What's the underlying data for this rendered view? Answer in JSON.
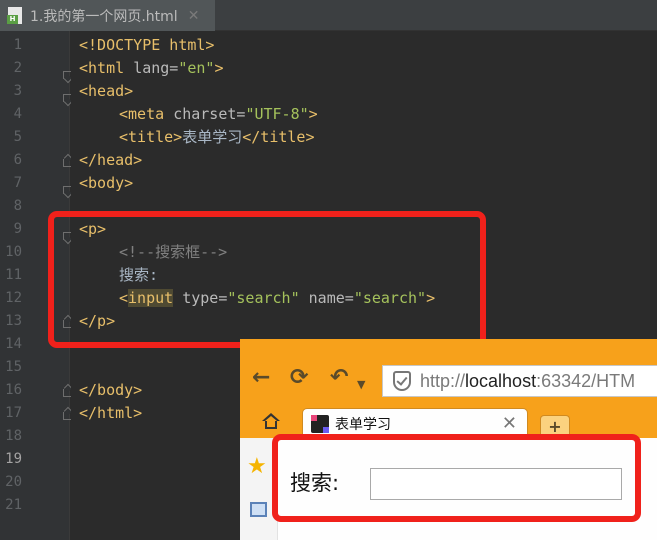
{
  "ide": {
    "tab": {
      "title": "1.我的第一个网页.html",
      "badge": "H",
      "close": "✕"
    },
    "line_numbers": [
      "1",
      "2",
      "3",
      "4",
      "5",
      "6",
      "7",
      "8",
      "9",
      "10",
      "11",
      "12",
      "13",
      "14",
      "15",
      "16",
      "17",
      "18",
      "19",
      "20",
      "21"
    ],
    "code": {
      "l1": {
        "a": "<!DOCTYPE html>"
      },
      "l2": {
        "a": "<html ",
        "b": "lang=",
        "c": "\"en\"",
        "d": ">"
      },
      "l3": {
        "a": "<head>"
      },
      "l4": {
        "a": "<meta ",
        "b": "charset=",
        "c": "\"UTF-8\"",
        "d": ">"
      },
      "l5": {
        "a": "<title>",
        "b": "表单学习",
        "c": "</title>"
      },
      "l6": {
        "a": "</head>"
      },
      "l7": {
        "a": "<body>"
      },
      "l9": {
        "a": "<p>"
      },
      "l10": {
        "a": "<!--搜索框-->"
      },
      "l11": {
        "a": "搜索:"
      },
      "l12": {
        "a": "<",
        "b": "input",
        "c": " type=",
        "d": "\"search\"",
        "e": " name=",
        "f": "\"search\"",
        "g": ">"
      },
      "l13": {
        "a": "</p>"
      },
      "l16": {
        "a": "</body>"
      },
      "l17": {
        "a": "</html>"
      }
    }
  },
  "browser": {
    "url_protocol": "http://",
    "url_host": "localhost",
    "url_rest": ":63342/HTM",
    "tab_title": "表单学习",
    "tab_close": "✕",
    "new_tab": "+",
    "search_label": "搜索:",
    "search_value": ""
  },
  "colors": {
    "highlight_box": "#f0211b",
    "browser_chrome": "#f7a11b",
    "tag": "#e8bf6a",
    "string": "#a5c25c",
    "comment": "#808080"
  },
  "icons": [
    "html-file-icon",
    "back-arrow-icon",
    "refresh-icon",
    "undo-icon",
    "shield-icon",
    "home-icon",
    "favicon-icon",
    "star-icon",
    "monitor-icon",
    "fold-icon"
  ]
}
